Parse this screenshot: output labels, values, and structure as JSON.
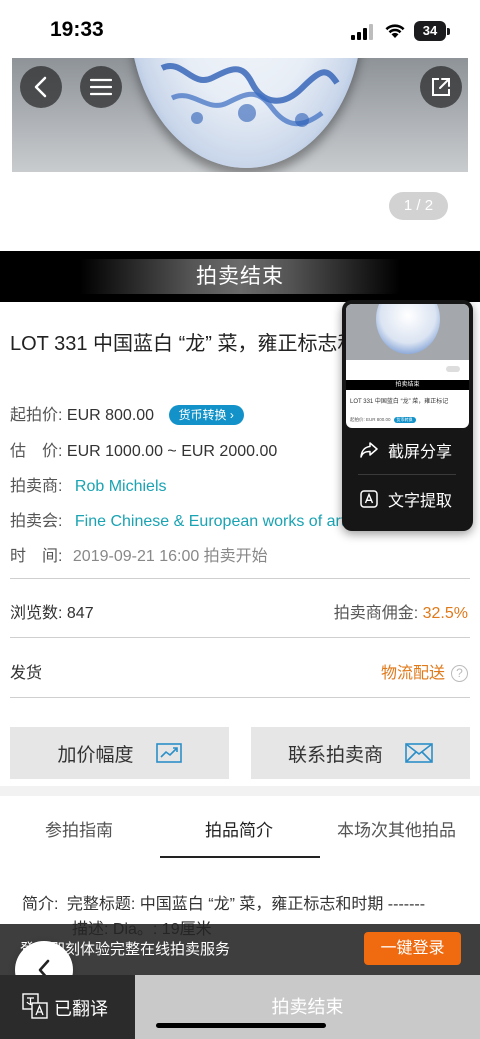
{
  "status_bar": {
    "time": "19:33",
    "battery": "34",
    "battery_level": 0.34
  },
  "gallery": {
    "pager": "1 / 2"
  },
  "banner": {
    "text": "拍卖结束"
  },
  "lot": {
    "title": "LOT 331 中国蓝白 “龙” 菜，雍正标志和时期",
    "start_price_label": "起拍价:",
    "start_price": "EUR 800.00",
    "currency_button": "货币转换",
    "estimate_label": "估　价:",
    "estimate": "EUR 1000.00 ~ EUR 2000.00",
    "auctioneer_label": "拍卖商:",
    "auctioneer": "Rob Michiels",
    "sale_label": "拍卖会:",
    "sale": "Fine Chinese & European works of art",
    "time_label": "时　间:",
    "time": "2019-09-21 16:00 拍卖开始"
  },
  "stats": {
    "views_label": "浏览数:",
    "views": "847",
    "commission_label": "拍卖商佣金:",
    "commission": "32.5%",
    "shipping_label": "发货",
    "shipping_value": "物流配送",
    "help": "?"
  },
  "actions": {
    "increment": "加价幅度",
    "contact": "联系拍卖商"
  },
  "tabs": [
    {
      "label": "参拍指南"
    },
    {
      "label": "拍品简介"
    },
    {
      "label": "本场次其他拍品"
    }
  ],
  "description": {
    "label": "简介:",
    "line1": "完整标题: 中国蓝白 “龙” 菜，雍正标志和时期 -------",
    "line2": "描述: Dia。: 19厘米"
  },
  "login_bar": {
    "text": "登录即刻体验完整在线拍卖服务",
    "button": "一键登录"
  },
  "bottom": {
    "translated": "已翻译",
    "ended": "拍卖结束"
  },
  "popup": {
    "share": "截屏分享",
    "extract": "文字提取",
    "thumb_banner": "拍卖结束",
    "thumb_title": "LOT 331 中国蓝白 “龙” 菜，雍正标记",
    "thumb_price": "起拍价: EUR 800.00",
    "thumb_pill": "货币转换"
  },
  "colors": {
    "teal": "#1aa3b3",
    "orange": "#e0791a",
    "login_orange": "#f06a0f",
    "pill_blue": "#1392c9"
  }
}
